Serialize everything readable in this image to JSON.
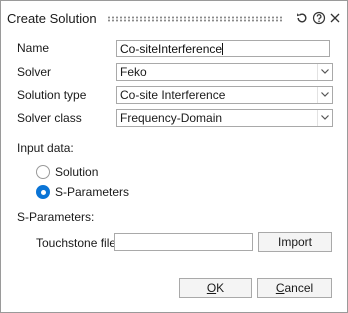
{
  "dialog": {
    "title": "Create Solution",
    "icons": [
      "reset-icon",
      "help-icon",
      "close-icon"
    ]
  },
  "form": {
    "name_label": "Name",
    "name_value": "Co-siteInterference",
    "solver_label": "Solver",
    "solver_value": "Feko",
    "solution_type_label": "Solution type",
    "solution_type_value": "Co-site Interference",
    "solver_class_label": "Solver class",
    "solver_class_value": "Frequency-Domain"
  },
  "input_data": {
    "label": "Input data:",
    "options": [
      {
        "label": "Solution",
        "selected": false
      },
      {
        "label": "S-Parameters",
        "selected": true
      }
    ]
  },
  "sparams": {
    "label": "S-Parameters:",
    "touchstone_label": "Touchstone file",
    "touchstone_value": "",
    "import_label": "Import"
  },
  "footer": {
    "ok_first": "O",
    "ok_rest": "K",
    "cancel_first": "C",
    "cancel_rest": "ancel"
  },
  "colors": {
    "accent": "#0a74d6",
    "border": "#a9a9a9"
  }
}
